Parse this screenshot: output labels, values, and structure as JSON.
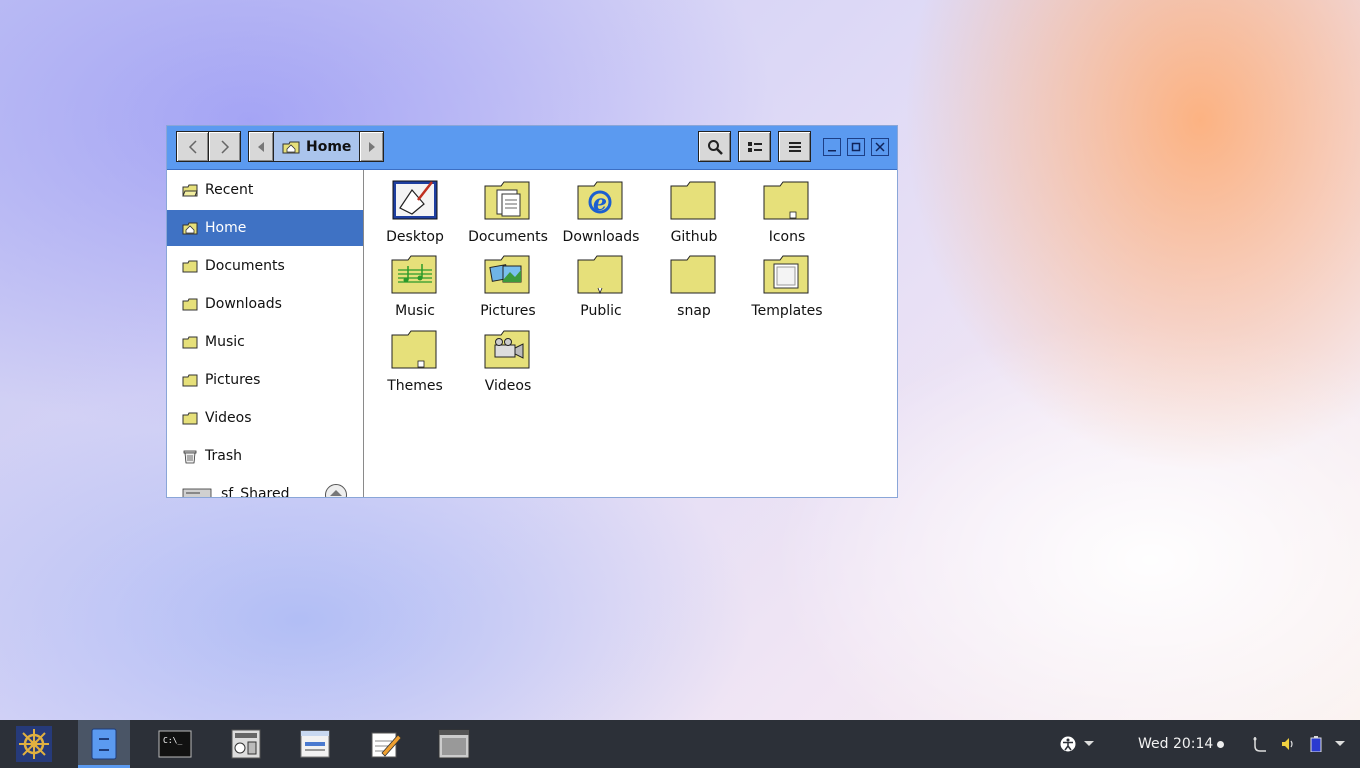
{
  "window": {
    "path_label": "Home",
    "sidebar": {
      "items": [
        {
          "label": "Recent",
          "icon": "recent-icon"
        },
        {
          "label": "Home",
          "icon": "home-icon",
          "active": true
        },
        {
          "label": "Documents",
          "icon": "folder-icon"
        },
        {
          "label": "Downloads",
          "icon": "folder-icon"
        },
        {
          "label": "Music",
          "icon": "folder-icon"
        },
        {
          "label": "Pictures",
          "icon": "folder-icon"
        },
        {
          "label": "Videos",
          "icon": "folder-icon"
        },
        {
          "label": "Trash",
          "icon": "trash-icon"
        },
        {
          "label": "sf_Shared",
          "icon": "drive-icon"
        }
      ]
    },
    "files": [
      {
        "label": "Desktop",
        "icon": "desktop-folder-icon"
      },
      {
        "label": "Documents",
        "icon": "documents-folder-icon"
      },
      {
        "label": "Downloads",
        "icon": "downloads-folder-icon"
      },
      {
        "label": "Github",
        "icon": "folder-icon"
      },
      {
        "label": "Icons",
        "icon": "link-folder-icon"
      },
      {
        "label": "Music",
        "icon": "music-folder-icon"
      },
      {
        "label": "Pictures",
        "icon": "pictures-folder-icon"
      },
      {
        "label": "Public",
        "icon": "public-folder-icon"
      },
      {
        "label": "snap",
        "icon": "folder-icon"
      },
      {
        "label": "Templates",
        "icon": "templates-folder-icon"
      },
      {
        "label": "Themes",
        "icon": "link-folder-icon"
      },
      {
        "label": "Videos",
        "icon": "videos-folder-icon"
      }
    ]
  },
  "taskbar": {
    "clock": "Wed 20:14",
    "apps": [
      "menu-icon",
      "files-icon",
      "terminal-icon",
      "control-panel-icon",
      "settings-window-icon",
      "text-editor-icon",
      "window-icon"
    ],
    "tray": [
      "accessibility-icon",
      "network-icon",
      "volume-icon",
      "battery-icon"
    ]
  },
  "colors": {
    "headerbar": "#5b9af0",
    "sidebar_active": "#3f72c4",
    "folder": "#e6e07a",
    "taskbar": "#2c3038"
  }
}
